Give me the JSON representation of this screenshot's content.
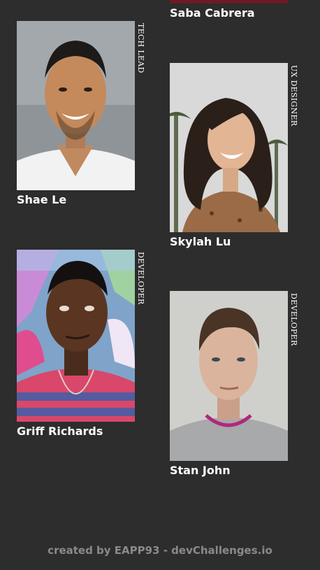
{
  "team": [
    {
      "name": "Saba Cabrera",
      "role": ""
    },
    {
      "name": "Shae Le",
      "role": "TECH LEAD"
    },
    {
      "name": "Skylah Lu",
      "role": "UX DESIGNER"
    },
    {
      "name": "Griff Richards",
      "role": "DEVELOPER"
    },
    {
      "name": "Stan John",
      "role": "DEVELOPER"
    }
  ],
  "footer": {
    "text": "created by EAPP93 - devChallenges.io"
  },
  "colors": {
    "background": "#2d2d2d",
    "text": "#ffffff",
    "footer_text": "#8a8a8a"
  }
}
